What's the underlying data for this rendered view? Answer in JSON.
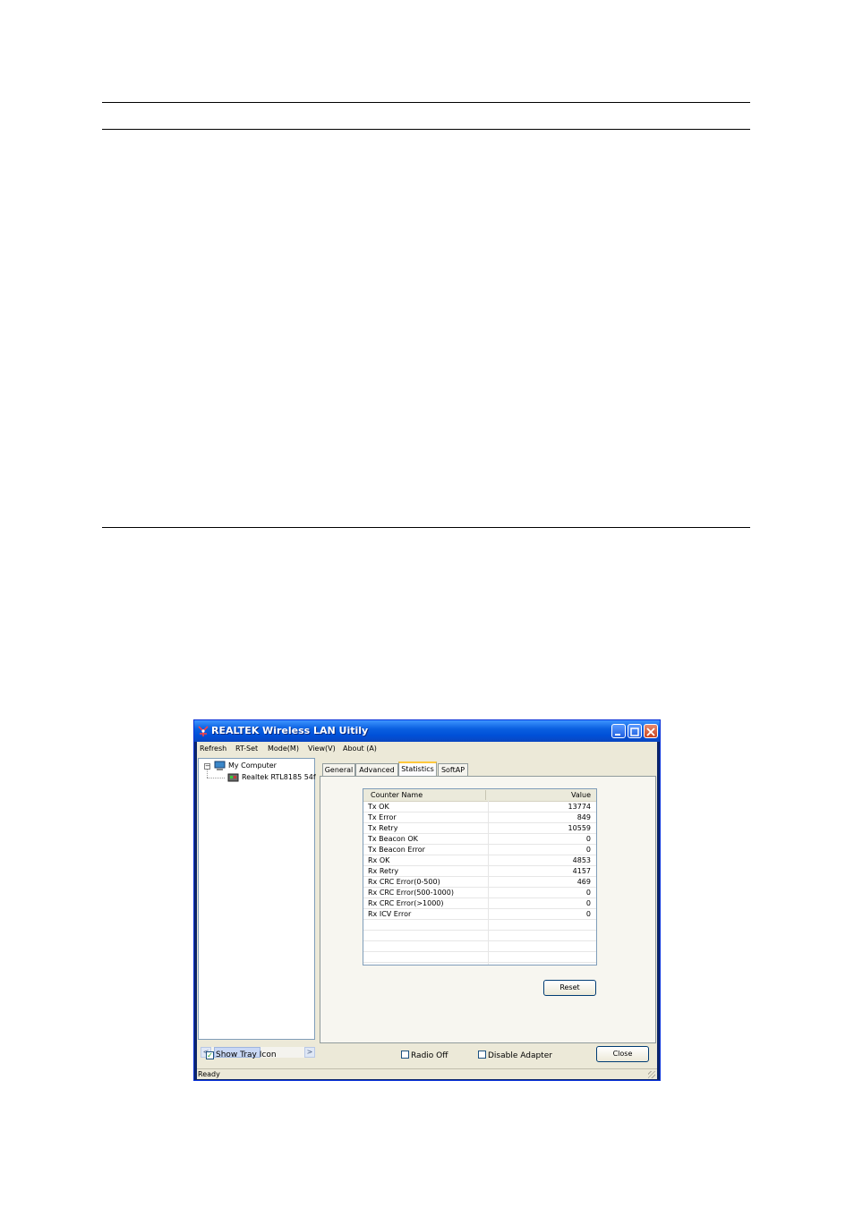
{
  "window": {
    "title": "REALTEK Wireless LAN Uitily"
  },
  "menubar": {
    "items": [
      "Refresh",
      "RT-Set",
      "Mode(M)",
      "View(V)",
      "About (A)"
    ]
  },
  "tree": {
    "root_label": "My Computer",
    "child_label": "Realtek RTL8185 54f"
  },
  "tabs": [
    "General",
    "Advanced",
    "Statistics",
    "SoftAP"
  ],
  "active_tab": "Statistics",
  "statistics": {
    "columns": [
      "Counter Name",
      "Value"
    ],
    "rows": [
      {
        "name": "Tx OK",
        "value": "13774"
      },
      {
        "name": "Tx Error",
        "value": "849"
      },
      {
        "name": "Tx Retry",
        "value": "10559"
      },
      {
        "name": "Tx Beacon OK",
        "value": "0"
      },
      {
        "name": "Tx Beacon Error",
        "value": "0"
      },
      {
        "name": "Rx OK",
        "value": "4853"
      },
      {
        "name": "Rx Retry",
        "value": "4157"
      },
      {
        "name": "Rx CRC Error(0-500)",
        "value": "469"
      },
      {
        "name": "Rx CRC Error(500-1000)",
        "value": "0"
      },
      {
        "name": "Rx CRC Error(>1000)",
        "value": "0"
      },
      {
        "name": "Rx ICV Error",
        "value": "0"
      }
    ],
    "reset_label": "Reset"
  },
  "footer": {
    "show_tray_icon": {
      "label": "Show Tray Icon",
      "checked": true
    },
    "radio_off": {
      "label": "Radio Off",
      "checked": false
    },
    "disable_adapter": {
      "label": "Disable Adapter",
      "checked": false
    },
    "close_label": "Close"
  },
  "status": "Ready",
  "colors": {
    "titlebar": "#0a5fe0",
    "face": "#ece9d8",
    "active_tab_accent": "#ffc83c"
  }
}
